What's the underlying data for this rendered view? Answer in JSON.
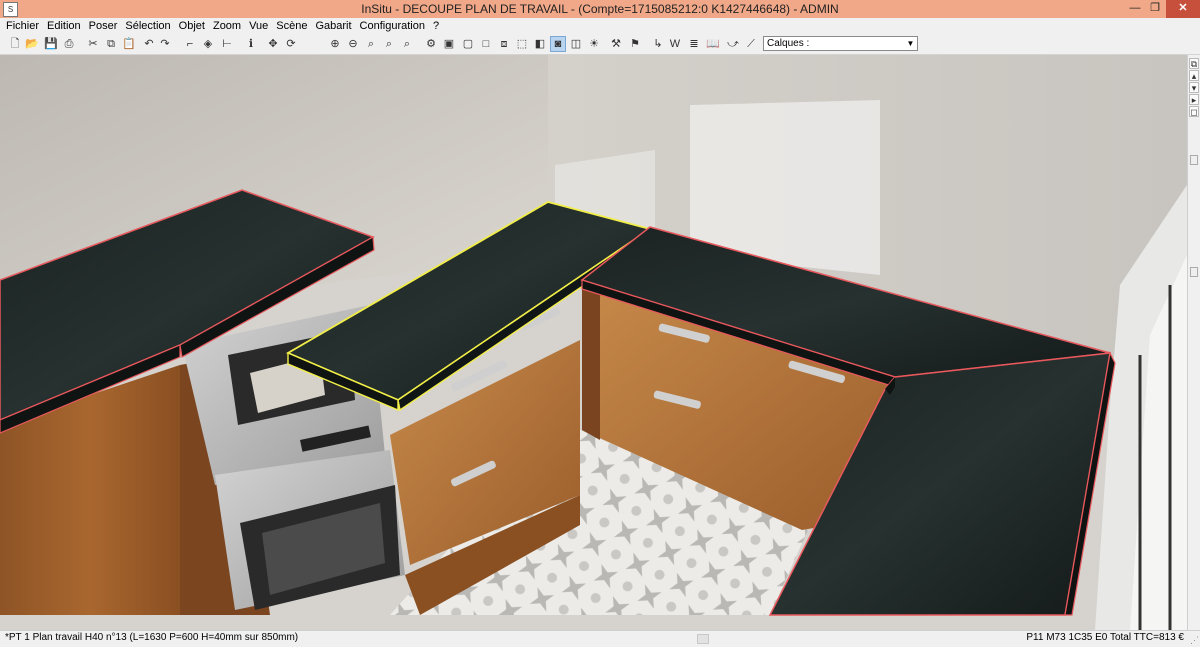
{
  "window": {
    "title": "InSitu - DECOUPE PLAN DE TRAVAIL - (Compte=1715085212:0 K1427446648) - ADMIN",
    "app_icon": "S",
    "minimize_glyph": "—",
    "maximize_glyph": "❐",
    "close_glyph": "✕"
  },
  "menu": [
    "Fichier",
    "Edition",
    "Poser",
    "Sélection",
    "Objet",
    "Zoom",
    "Vue",
    "Scène",
    "Gabarit",
    "Configuration",
    "?"
  ],
  "toolbar": {
    "icons": [
      {
        "name": "new-file-icon",
        "glyph": "🗋"
      },
      {
        "name": "open-folder-icon",
        "glyph": "📂"
      },
      {
        "name": "save-icon",
        "glyph": "💾"
      },
      {
        "name": "print-icon",
        "glyph": "⎙"
      },
      {
        "name": "cut-icon",
        "glyph": "✂"
      },
      {
        "name": "copy-icon",
        "glyph": "⧉"
      },
      {
        "name": "paste-icon",
        "glyph": "📋"
      },
      {
        "name": "undo-icon",
        "glyph": "↶"
      },
      {
        "name": "redo-icon",
        "glyph": "↷"
      },
      {
        "name": "pipe-tool-icon",
        "glyph": "⌐"
      },
      {
        "name": "texture-tool-icon",
        "glyph": "◈"
      },
      {
        "name": "measure-tool-icon",
        "glyph": "⊢"
      },
      {
        "name": "info-icon",
        "glyph": "ℹ"
      },
      {
        "name": "move-icon",
        "glyph": "✥"
      },
      {
        "name": "rotate-icon",
        "glyph": "⟳"
      },
      {
        "name": "zoom-in-icon",
        "glyph": "⊕"
      },
      {
        "name": "zoom-out-icon",
        "glyph": "⊖"
      },
      {
        "name": "zoom-window-icon",
        "glyph": "⌕"
      },
      {
        "name": "zoom-all-icon",
        "glyph": "⌕"
      },
      {
        "name": "zoom-previous-icon",
        "glyph": "⌕"
      },
      {
        "name": "render-camera-icon",
        "glyph": "⚙"
      },
      {
        "name": "wireframe-view-icon",
        "glyph": "▣"
      },
      {
        "name": "plan-view-icon",
        "glyph": "▢"
      },
      {
        "name": "elevation-view-icon",
        "glyph": "□"
      },
      {
        "name": "shaded-view-icon",
        "glyph": "⧈"
      },
      {
        "name": "box-view-icon",
        "glyph": "⬚"
      },
      {
        "name": "3d-view-icon",
        "glyph": "◧"
      },
      {
        "name": "camera-view-icon",
        "glyph": "◙"
      },
      {
        "name": "photo-render-icon",
        "glyph": "◫"
      },
      {
        "name": "light-icon",
        "glyph": "☀"
      },
      {
        "name": "texture-brush-icon",
        "glyph": "⚒"
      },
      {
        "name": "object-tool-icon",
        "glyph": "⚑"
      },
      {
        "name": "dimension-icon",
        "glyph": "↳"
      },
      {
        "name": "word-export-icon",
        "glyph": "W"
      },
      {
        "name": "list-export-icon",
        "glyph": "≣"
      },
      {
        "name": "book-icon",
        "glyph": "📖"
      },
      {
        "name": "curve-tool-icon",
        "glyph": "⤻"
      },
      {
        "name": "line-tool-icon",
        "glyph": "⟋"
      }
    ],
    "layers_label": "Calques :",
    "dropdown_arrow": "▼"
  },
  "side_panel": {
    "buttons": [
      "⧉",
      "▴",
      "▾",
      "▸",
      "◻"
    ]
  },
  "status": {
    "left": "*PT 1   Plan travail H40 n°13  (L=1630 P=600 H=40mm sur 850mm)",
    "right": "P11 M73  1C35 E0 Total TTC=813 €",
    "grip": "⋰"
  },
  "colors": {
    "title_bar": "#f0a889",
    "close_button": "#c7503c",
    "selected_outline": "#f2ee48",
    "outline": "#e8585c",
    "countertop": "#151b1a",
    "wood": "#9b5d2b",
    "wall": "#d8d4cf"
  }
}
